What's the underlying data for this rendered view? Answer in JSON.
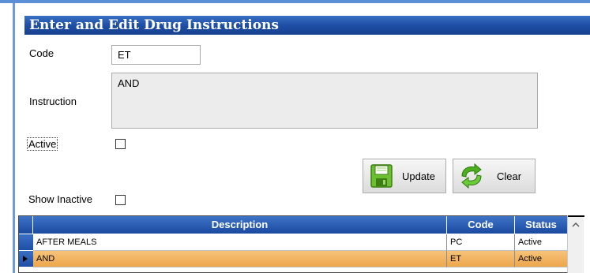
{
  "form": {
    "title": "Enter and Edit Drug Instructions",
    "code_label": "Code",
    "code_value": "ET",
    "instruction_label": "Instruction",
    "instruction_value": "AND",
    "active_label": "Active",
    "active_checked": false,
    "show_inactive_label": "Show Inactive",
    "show_inactive_checked": false
  },
  "buttons": {
    "update_label": "Update",
    "update_icon": "floppy-disk-icon",
    "clear_label": "Clear",
    "clear_icon": "recycle-arrows-icon"
  },
  "grid": {
    "columns": [
      "Description",
      "Code",
      "Status"
    ],
    "rows": [
      {
        "description": "AFTER MEALS",
        "code": "PC",
        "status": "Active",
        "selected": false
      },
      {
        "description": "AND",
        "code": "ET",
        "status": "Active",
        "selected": true
      }
    ]
  },
  "colors": {
    "title_bar": "#1e4fa6",
    "selected_row": "#eda64a"
  }
}
